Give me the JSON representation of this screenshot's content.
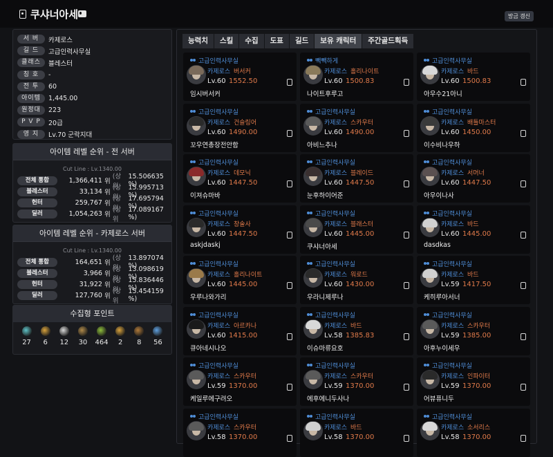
{
  "header": {
    "title": "쿠샤너아세",
    "refresh_label": "방금 갱신"
  },
  "profile": [
    {
      "key": "서 버",
      "value": "카제로스"
    },
    {
      "key": "길 드",
      "value": "고급인력사무실"
    },
    {
      "key": "클래스",
      "value": "블레스터"
    },
    {
      "key": "칭 호",
      "value": "-"
    },
    {
      "key": "전 투",
      "value": "60"
    },
    {
      "key": "아이템",
      "value": "1,445.00"
    },
    {
      "key": "원정대",
      "value": "223"
    },
    {
      "key": "P V P",
      "value": "20급"
    },
    {
      "key": "영 지",
      "value": "Lv.70 군락지대"
    }
  ],
  "ranking_all": {
    "title": "아이템 레벨 순위 - 전 서버",
    "cutline": "Cut Line : Lv.1340.00",
    "rows": [
      {
        "label": "전체 통합",
        "rank": "1,366,411",
        "unit": "위",
        "pct_label": "(상위",
        "pct": "15.506635 %)"
      },
      {
        "label": "블레스터",
        "rank": "33,134",
        "unit": "위",
        "pct_label": "(상위",
        "pct": "15.995713 %)"
      },
      {
        "label": "헌터",
        "rank": "259,767",
        "unit": "위",
        "pct_label": "(상위",
        "pct": "17.695794 %)"
      },
      {
        "label": "딜러",
        "rank": "1,054,263",
        "unit": "위",
        "pct_label": "(상위",
        "pct": "17.089167 %)"
      }
    ]
  },
  "ranking_server": {
    "title": "아이템 레벨 순위 - 카제로스 서버",
    "cutline": "Cut Line : Lv.1340.00",
    "rows": [
      {
        "label": "전체 통합",
        "rank": "164,651",
        "unit": "위",
        "pct_label": "(상위",
        "pct": "13.897074 %)"
      },
      {
        "label": "블레스터",
        "rank": "3,966",
        "unit": "위",
        "pct_label": "(상위",
        "pct": "13.098619 %)"
      },
      {
        "label": "헌터",
        "rank": "31,922",
        "unit": "위",
        "pct_label": "(상위",
        "pct": "15.836446 %)"
      },
      {
        "label": "딜러",
        "rank": "127,760",
        "unit": "위",
        "pct_label": "(상위",
        "pct": "15.454159 %)"
      }
    ]
  },
  "collection": {
    "title": "수집형 포인트",
    "items": [
      {
        "icon": "island-soul-icon",
        "color": "#5fc3c8",
        "count": "27"
      },
      {
        "icon": "giant-heart-icon",
        "color": "#d9a33d",
        "count": "6"
      },
      {
        "icon": "art-icon",
        "color": "#d8d8d8",
        "count": "12"
      },
      {
        "icon": "mokoko-seed-icon",
        "color": "#b08a4a",
        "count": "30"
      },
      {
        "icon": "adventure-tome-icon",
        "color": "#8fbf3c",
        "count": "464"
      },
      {
        "icon": "ignea-token-icon",
        "color": "#d9a33d",
        "count": "2"
      },
      {
        "icon": "sea-bounty-icon",
        "color": "#b07a3a",
        "count": "8"
      },
      {
        "icon": "world-tree-leaf-icon",
        "color": "#5fa0e0",
        "count": "56"
      }
    ]
  },
  "tabs": [
    "능력치",
    "스킬",
    "수집",
    "도표",
    "길드",
    "보유 캐릭터",
    "주간골드획득"
  ],
  "active_tab": "보유 캐릭터",
  "characters": [
    {
      "guild": "고급인력사무실",
      "server": "카제로스",
      "class": "버서커",
      "level": "Lv.60",
      "ilvl": "1552.50",
      "name": "임시버서커",
      "hair": "#7a6a5a"
    },
    {
      "guild": "빽빽하게",
      "server": "카제로스",
      "class": "홀리나이트",
      "level": "Lv.60",
      "ilvl": "1500.83",
      "name": "나이트후루고",
      "hair": "#8a7a5a"
    },
    {
      "guild": "고급인력사무실",
      "server": "카제로스",
      "class": "바드",
      "level": "Lv.60",
      "ilvl": "1500.83",
      "name": "아우수21아니",
      "hair": "#d8d8d8"
    },
    {
      "guild": "고급인력사무실",
      "server": "카제로스",
      "class": "건슬링어",
      "level": "Lv.60",
      "ilvl": "1490.00",
      "name": "꼬우연총장전안함",
      "hair": "#2a2a2a"
    },
    {
      "guild": "고급인력사무실",
      "server": "카제로스",
      "class": "스카우터",
      "level": "Lv.60",
      "ilvl": "1490.00",
      "name": "아비느추나",
      "hair": "#5a5a5a"
    },
    {
      "guild": "고급인력사무실",
      "server": "카제로스",
      "class": "배틀마스터",
      "level": "Lv.60",
      "ilvl": "1450.00",
      "name": "이수비나우하",
      "hair": "#3a3a3a"
    },
    {
      "guild": "고급인력사무실",
      "server": "카제로스",
      "class": "데모닉",
      "level": "Lv.60",
      "ilvl": "1447.50",
      "name": "이져슈마바",
      "hair": "#8a2a2a"
    },
    {
      "guild": "고급인력사무실",
      "server": "카제로스",
      "class": "블레이드",
      "level": "Lv.60",
      "ilvl": "1447.50",
      "name": "눈후하이어준",
      "hair": "#3a3030"
    },
    {
      "guild": "고급인력사무실",
      "server": "카제로스",
      "class": "서머너",
      "level": "Lv.60",
      "ilvl": "1447.50",
      "name": "아우이나사",
      "hair": "#5a5050"
    },
    {
      "guild": "고급인력사무실",
      "server": "카제로스",
      "class": "창술사",
      "level": "Lv.60",
      "ilvl": "1447.50",
      "name": "askjdaskj",
      "hair": "#2a2a2a"
    },
    {
      "guild": "고급인력사무실",
      "server": "카제로스",
      "class": "블래스터",
      "level": "Lv.60",
      "ilvl": "1445.00",
      "name": "쿠샤너아세",
      "hair": "#4a4a4a"
    },
    {
      "guild": "고급인력사무실",
      "server": "카제로스",
      "class": "바드",
      "level": "Lv.60",
      "ilvl": "1445.00",
      "name": "dasdkas",
      "hair": "#d0d0d0"
    },
    {
      "guild": "고급인력사무실",
      "server": "카제로스",
      "class": "홀리나이트",
      "level": "Lv.60",
      "ilvl": "1445.00",
      "name": "우루나와가리",
      "hair": "#9a7a4a"
    },
    {
      "guild": "고급인력사무실",
      "server": "카제로스",
      "class": "워로드",
      "level": "Lv.60",
      "ilvl": "1430.00",
      "name": "우라니제루나",
      "hair": "#2a2a2a"
    },
    {
      "guild": "고급인력사무실",
      "server": "카제로스",
      "class": "바드",
      "level": "Lv.59",
      "ilvl": "1417.50",
      "name": "케히루아서너",
      "hair": "#d0d0d0"
    },
    {
      "guild": "고급인력사무실",
      "server": "카제로스",
      "class": "아르카나",
      "level": "Lv.60",
      "ilvl": "1415.00",
      "name": "큐아네시나오",
      "hair": "#1a1a1a"
    },
    {
      "guild": "고급인력사무실",
      "server": "카제로스",
      "class": "바드",
      "level": "Lv.58",
      "ilvl": "1385.83",
      "name": "이슈마류요호",
      "hair": "#d8d8d8"
    },
    {
      "guild": "고급인력사무실",
      "server": "카제로스",
      "class": "스카우터",
      "level": "Lv.59",
      "ilvl": "1385.00",
      "name": "아후누이세우",
      "hair": "#5a5a5a"
    },
    {
      "guild": "고급인력사무실",
      "server": "카제로스",
      "class": "스카우터",
      "level": "Lv.59",
      "ilvl": "1370.00",
      "name": "케일루에구려오",
      "hair": "#5a5a5a"
    },
    {
      "guild": "고급인력사무실",
      "server": "카제로스",
      "class": "스카우터",
      "level": "Lv.59",
      "ilvl": "1370.00",
      "name": "에후에니두사나",
      "hair": "#5a5a5a"
    },
    {
      "guild": "고급인력사무실",
      "server": "카제로스",
      "class": "인파이터",
      "level": "Lv.59",
      "ilvl": "1370.00",
      "name": "어뷰퓨니두",
      "hair": "#2a2a2a"
    },
    {
      "guild": "고급인력사무실",
      "server": "카제로스",
      "class": "스카우터",
      "level": "Lv.58",
      "ilvl": "1370.00",
      "name": "",
      "hair": "#5a5a5a"
    },
    {
      "guild": "고급인력사무실",
      "server": "카제로스",
      "class": "바드",
      "level": "Lv.58",
      "ilvl": "1370.00",
      "name": "",
      "hair": "#d0d0d0"
    },
    {
      "guild": "고급인력사무실",
      "server": "카제로스",
      "class": "소서리스",
      "level": "Lv.58",
      "ilvl": "1370.00",
      "name": "",
      "hair": "#d8d8d8"
    }
  ]
}
